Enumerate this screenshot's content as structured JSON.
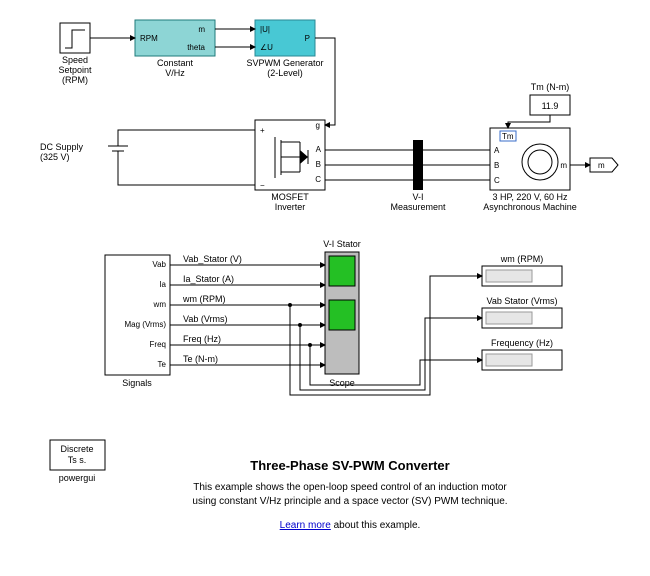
{
  "title": "Three-Phase SV-PWM Converter",
  "description_line1": "This example shows the open-loop speed control of an induction motor",
  "description_line2": "using constant V/Hz principle and a space vector (SV) PWM technique.",
  "learn_more": "Learn more",
  "learn_more_after": " about this example.",
  "blocks": {
    "speed_setpoint": {
      "label_line1": "Speed",
      "label_line2": "Setpoint",
      "label_line3": "(RPM)"
    },
    "constant_vhz": {
      "label_line1": "Constant",
      "label_line2": "V/Hz",
      "in": "RPM",
      "out_top": "m",
      "out_bot": "theta"
    },
    "svpwm": {
      "label_line1": "SVPWM Generator",
      "label_line2": "(2-Level)",
      "in_top": "|U|",
      "in_bot": "∠U",
      "out": "P"
    },
    "dc_supply": {
      "label_line1": "DC Supply",
      "label_line2": "(325 V)"
    },
    "mosfet": {
      "label_line1": "MOSFET",
      "label_line2": "Inverter",
      "port_g": "g",
      "port_plus": "+",
      "port_minus": "−",
      "port_a": "A",
      "port_b": "B",
      "port_c": "C"
    },
    "vi_meas": {
      "label_line1": "V-I",
      "label_line2": "Measurement"
    },
    "tm": {
      "label": "Tm (N-m)",
      "value": "11.9"
    },
    "async": {
      "label_line1": "3 HP, 220 V, 60 Hz",
      "label_line2": "Asynchronous Machine",
      "port_tm": "Tm",
      "port_a": "A",
      "port_b": "B",
      "port_c": "C",
      "port_m": "m"
    },
    "goto_m": {
      "tag": "m"
    },
    "signals": {
      "label": "Signals",
      "ports": [
        "Vab",
        "Ia",
        "wm",
        "Mag (Vrms)",
        "Freq",
        "Te"
      ],
      "out_labels": [
        "Vab_Stator (V)",
        "Ia_Stator (A)",
        "wm (RPM)",
        "Vab (Vrms)",
        "Freq (Hz)",
        "Te (N-m)"
      ]
    },
    "scope": {
      "label": "Scope",
      "top_label": "V-I Stator"
    },
    "disp_wm": {
      "label": "wm (RPM)"
    },
    "disp_vab": {
      "label": "Vab Stator (Vrms)"
    },
    "disp_freq": {
      "label": "Frequency (Hz)"
    },
    "powergui": {
      "line1": "Discrete",
      "line2": "Ts s.",
      "label": "powergui"
    }
  }
}
